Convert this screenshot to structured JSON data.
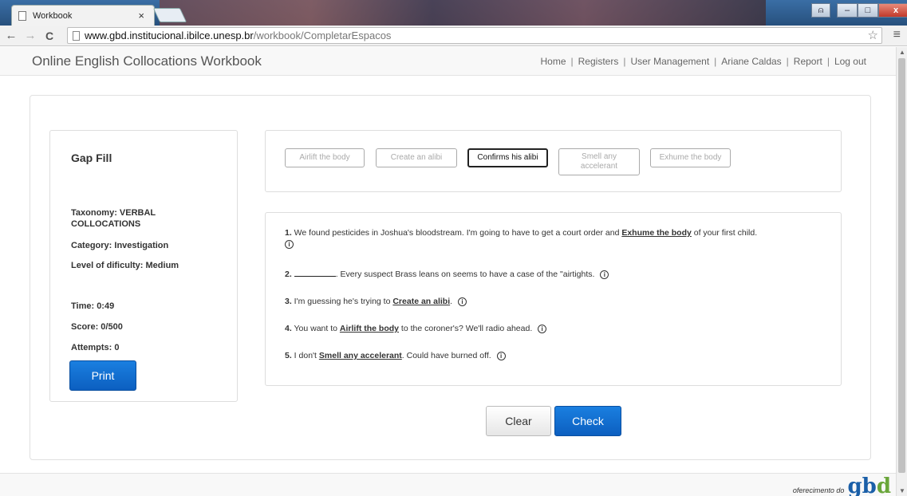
{
  "browser": {
    "tab_title": "Workbook",
    "tab_close": "×",
    "url_host": "www.gbd.institucional.ibilce.unesp.br",
    "url_path": "/workbook/CompletarEspacos",
    "back_icon": "←",
    "forward_icon": "→",
    "reload_icon": "C",
    "star_icon": "☆",
    "menu_icon": "≡",
    "win_user": "⍝",
    "win_min": "–",
    "win_max": "□",
    "win_close": "x"
  },
  "navbar": {
    "brand": "Online English Collocations Workbook",
    "links": [
      "Home",
      "Registers",
      "User Management",
      "Ariane Caldas",
      "Report",
      "Log out"
    ],
    "separator": "|"
  },
  "sidebar": {
    "title": "Gap Fill",
    "taxonomy": "Taxonomy: VERBAL COLLOCATIONS",
    "category": "Category: Investigation",
    "level": "Level of dificulty: Medium",
    "time": "Time: 0:49",
    "score": "Score: 0/500",
    "attempts": "Attempts: 0",
    "print_label": "Print"
  },
  "options": [
    {
      "label": "Airlift the body",
      "active": false
    },
    {
      "label": "Create an alibi",
      "active": false
    },
    {
      "label": "Confirms his alibi",
      "active": true
    },
    {
      "label": "Smell any accelerant",
      "active": false
    },
    {
      "label": "Exhume the body",
      "active": false
    }
  ],
  "questions": {
    "q1": {
      "num": "1.",
      "pre": " We found pesticides in Joshua's bloodstream. I'm going to have to get a court order and ",
      "ans": "Exhume the body",
      "post": " of your first child."
    },
    "q2": {
      "num": "2.",
      "pre": " ",
      "post": ". Every suspect Brass leans on seems to have a case of the \"airtights."
    },
    "q3": {
      "num": "3.",
      "pre": " I'm guessing he's trying to ",
      "ans": "Create an alibi",
      "post": "."
    },
    "q4": {
      "num": "4.",
      "pre": " You want to ",
      "ans": "Airlift the body",
      "post": " to the coroner's? We'll radio ahead."
    },
    "q5": {
      "num": "5.",
      "pre": " I don't ",
      "ans": "Smell any accelerant",
      "post": ". Could have burned off."
    },
    "info_glyph": "i"
  },
  "actions": {
    "clear_label": "Clear",
    "check_label": "Check"
  },
  "footer": {
    "small_text": "oferecimento do",
    "logo_g": "g",
    "logo_b": "b",
    "logo_d": "d"
  },
  "colors": {
    "primary_button": "#0c5fc0",
    "chip_border": "#aaaaaa",
    "active_chip_border": "#222222"
  }
}
